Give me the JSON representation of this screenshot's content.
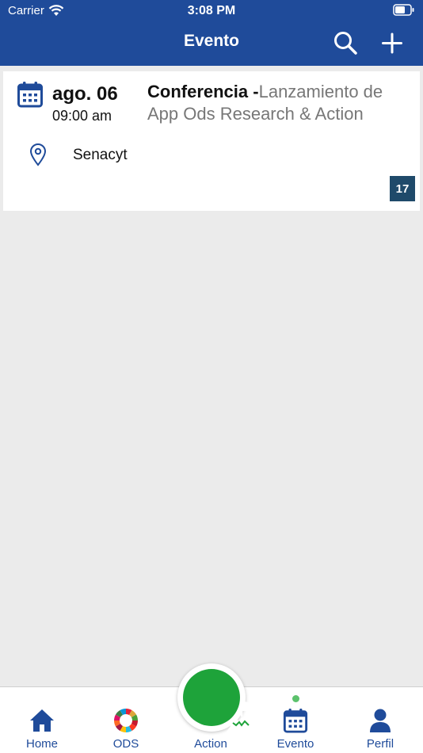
{
  "status_bar": {
    "carrier": "Carrier",
    "time": "3:08 PM"
  },
  "nav": {
    "title": "Evento",
    "icons": [
      "search-icon",
      "plus-icon"
    ]
  },
  "event": {
    "date": "ago. 06",
    "time": "09:00 am",
    "type": "Conferencia -",
    "title": "Lanzamiento de App Ods Research & Action",
    "location": "Senacyt",
    "badge": "17",
    "icons": [
      "calendar-icon",
      "map-pin-icon"
    ]
  },
  "tabbar": {
    "items": [
      {
        "label": "Home",
        "icon": "home-icon"
      },
      {
        "label": "ODS",
        "icon": "ods-wheel-icon"
      },
      {
        "label": "Action",
        "icon": "mountain-flag-icon"
      },
      {
        "label": "Evento",
        "icon": "calendar-icon"
      },
      {
        "label": "Perfil",
        "icon": "person-icon"
      }
    ],
    "active": "Evento"
  },
  "colors": {
    "primary": "#1f4b9a",
    "action_green": "#1ea33a",
    "badge_bg": "#1f4a6a",
    "active_dot": "#5cc26c",
    "background": "#ebebeb"
  }
}
